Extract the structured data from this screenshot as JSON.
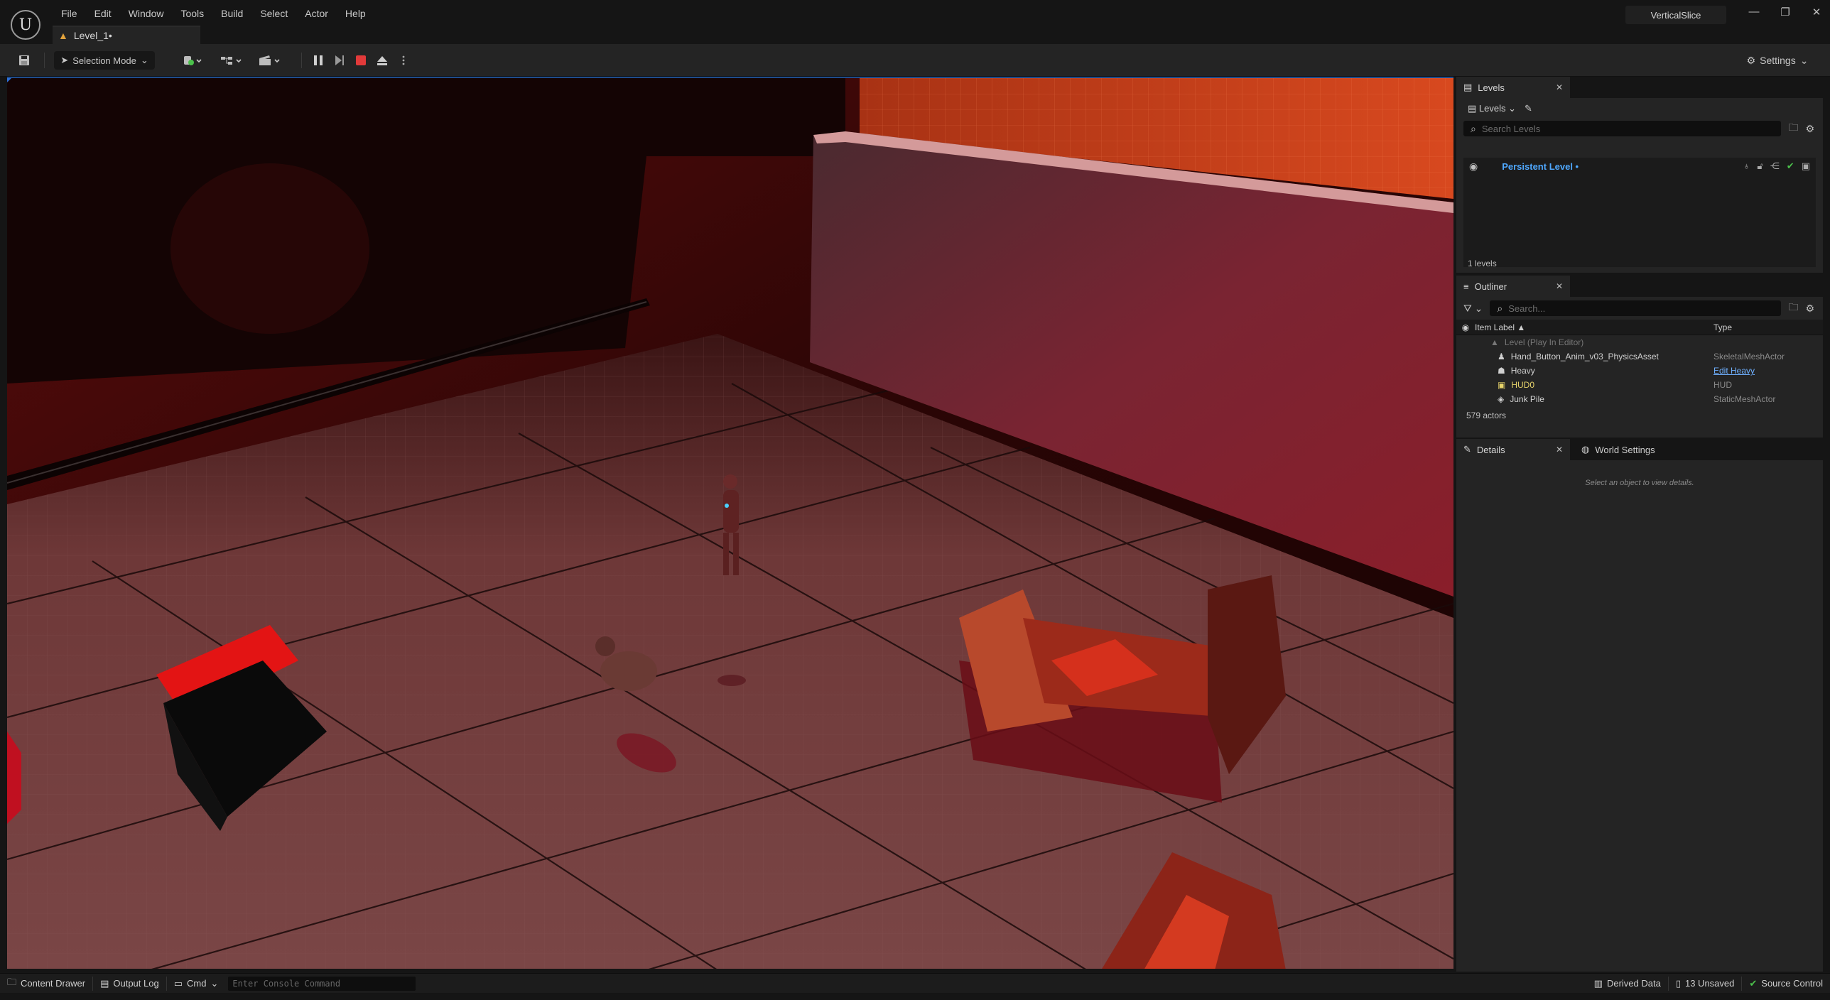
{
  "app": {
    "logo": "U",
    "project_name": "VerticalSlice",
    "level_tab": "Level_1•",
    "menu": [
      "File",
      "Edit",
      "Window",
      "Tools",
      "Build",
      "Select",
      "Actor",
      "Help"
    ]
  },
  "toolbar": {
    "mode_label": "Selection Mode",
    "settings_label": "Settings"
  },
  "levels_panel": {
    "tab_label": "Levels",
    "dropdown_label": "Levels",
    "search_placeholder": "Search Levels",
    "rows": [
      {
        "name": "Persistent Level •"
      }
    ],
    "footer": "1 levels"
  },
  "outliner": {
    "tab_label": "Outliner",
    "search_placeholder": "Search...",
    "columns": {
      "label": "Item Label ▲",
      "type": "Type"
    },
    "rows": [
      {
        "label": "Level (Play In Editor)",
        "type": "",
        "icon": "level-icon"
      },
      {
        "label": "Hand_Button_Anim_v03_PhysicsAsset",
        "type": "SkeletalMeshActor",
        "icon": "skeletal-mesh-icon"
      },
      {
        "label": "Heavy",
        "type": "Edit Heavy",
        "icon": "character-icon"
      },
      {
        "label": "HUD0",
        "type": "HUD",
        "icon": "hud-icon"
      },
      {
        "label": "Junk Pile",
        "type": "StaticMeshActor",
        "icon": "static-mesh-icon"
      }
    ],
    "footer": "579 actors"
  },
  "details": {
    "tab_label": "Details",
    "world_settings_label": "World Settings",
    "hint": "Select an object to view details."
  },
  "statusbar": {
    "content_drawer": "Content Drawer",
    "output_log": "Output Log",
    "cmd": "Cmd",
    "console_placeholder": "Enter Console Command",
    "derived_data": "Derived Data",
    "unsaved": "13 Unsaved",
    "source_control": "Source Control"
  },
  "colors": {
    "accent_blue": "#1f4c8c",
    "stop_red": "#e23a3a",
    "level_link": "#4fa8ff",
    "check_green": "#4cc24c"
  }
}
